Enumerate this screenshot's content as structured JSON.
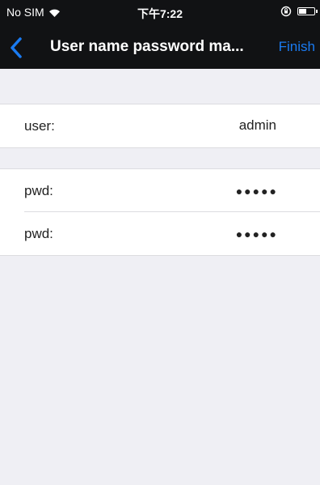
{
  "status_bar": {
    "carrier": "No SIM",
    "time": "下午7:22"
  },
  "nav": {
    "title": "User name password ma...",
    "finish_label": "Finish"
  },
  "fields": [
    {
      "label": "user:",
      "value": "admin"
    },
    {
      "label": "pwd:",
      "value": "●●●●●"
    },
    {
      "label": "pwd:",
      "value": "●●●●●"
    }
  ],
  "colors": {
    "bar_background": "#111214",
    "accent": "#1a7bf2",
    "grouped_background": "#efeff4"
  }
}
